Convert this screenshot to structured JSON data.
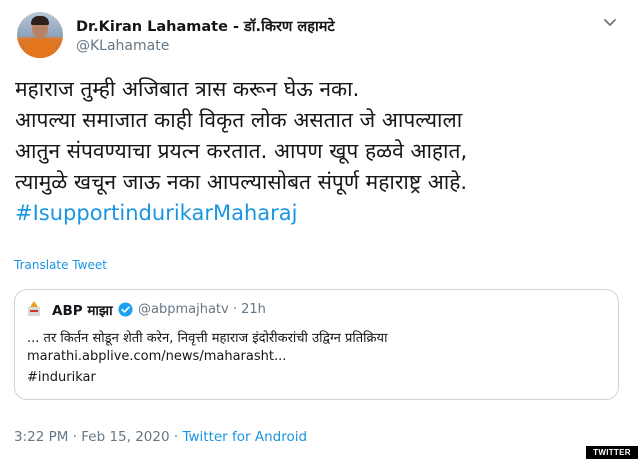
{
  "author": {
    "display_name": "Dr.Kiran Lahamate - डॉ.किरण लहामटे",
    "handle": "@KLahamate",
    "avatar_icon": "profile-photo"
  },
  "tweet": {
    "lines": [
      "महाराज तुम्ही अजिबात त्रास करून घेऊ नका.",
      "आपल्या समाजात काही विकृत लोक असतात जे आपल्याला",
      "आतुन संपवण्याचा प्रयत्न करतात. आपण खूप हळवे आहात,",
      "त्यामुळे खचून जाऊ नका आपल्यासोबत संपूर्ण महाराष्ट्र आहे."
    ],
    "hashtag": "#IsupportindurikarMaharaj",
    "translate_label": "Translate Tweet"
  },
  "quoted_tweet": {
    "name": "ABP माझा",
    "handle": "@abpmajhatv",
    "separator": "·",
    "time": "21h",
    "text": "... तर किर्तन सोडून शेती करेन, निवृत्ती महाराज इंदोरीकरांची उद्विग्न प्रतिक्रिया",
    "link": "marathi.abplive.com/news/maharasht...",
    "hashtag": "#indurikar",
    "verified_color": "#1da1f2"
  },
  "footer": {
    "timestamp": "3:22 PM · Feb 15, 2020 · ",
    "source": "Twitter for Android"
  },
  "watermark": "TWITTER",
  "colors": {
    "link": "#1b95e0",
    "secondary_text": "#657786",
    "border": "#ccd6dd"
  }
}
